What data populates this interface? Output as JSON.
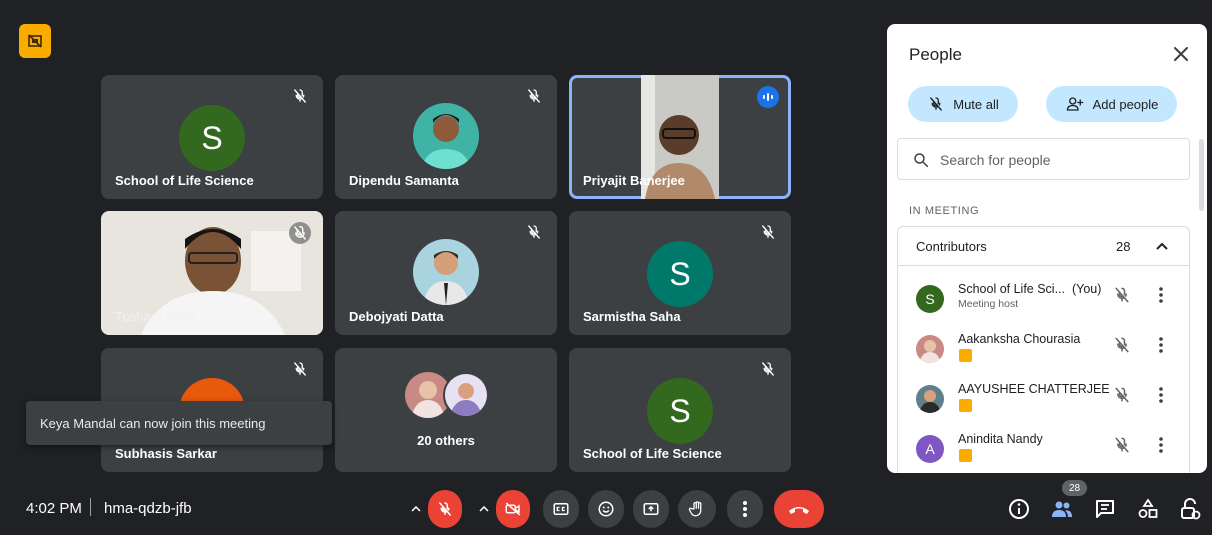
{
  "tiles": [
    {
      "name": "School of Life Science",
      "letter": "S",
      "color": "#33691e"
    },
    {
      "name": "Dipendu Samanta"
    },
    {
      "name": "Priyajit Banerjee"
    },
    {
      "name": "Tushar Lodha"
    },
    {
      "name": "Debojyati Datta"
    },
    {
      "name": "Sarmistha Saha",
      "letter": "S",
      "color": "#00796b"
    },
    {
      "name": "Subhasis Sarkar"
    },
    {
      "name": "20 others"
    },
    {
      "name": "School of Life Science",
      "letter": "S",
      "color": "#33691e"
    }
  ],
  "toast": "Keya Mandal can now join this meeting",
  "bottom_bar": {
    "time": "4:02 PM",
    "meeting_code": "hma-qdzb-jfb",
    "people_count": "28"
  },
  "panel": {
    "title": "People",
    "mute_all": "Mute all",
    "add_people": "Add people",
    "search_placeholder": "Search for people",
    "section": "IN MEETING",
    "group": {
      "label": "Contributors",
      "count": "28"
    },
    "people": [
      {
        "name": "School of Life Sci...",
        "suffix": "(You)",
        "sub": "Meeting host",
        "letter": "S",
        "color": "#33691e"
      },
      {
        "name": "Aakanksha Chourasia"
      },
      {
        "name": "AAYUSHEE CHATTERJEE"
      },
      {
        "name": "Anindita Nandy",
        "letter": "A",
        "color": "#7e57c2"
      }
    ]
  },
  "colors": {
    "accent": "#8ab4f8",
    "end_call": "#ea4335",
    "pill": "#c2e7ff",
    "badge": "#f9ab00"
  }
}
